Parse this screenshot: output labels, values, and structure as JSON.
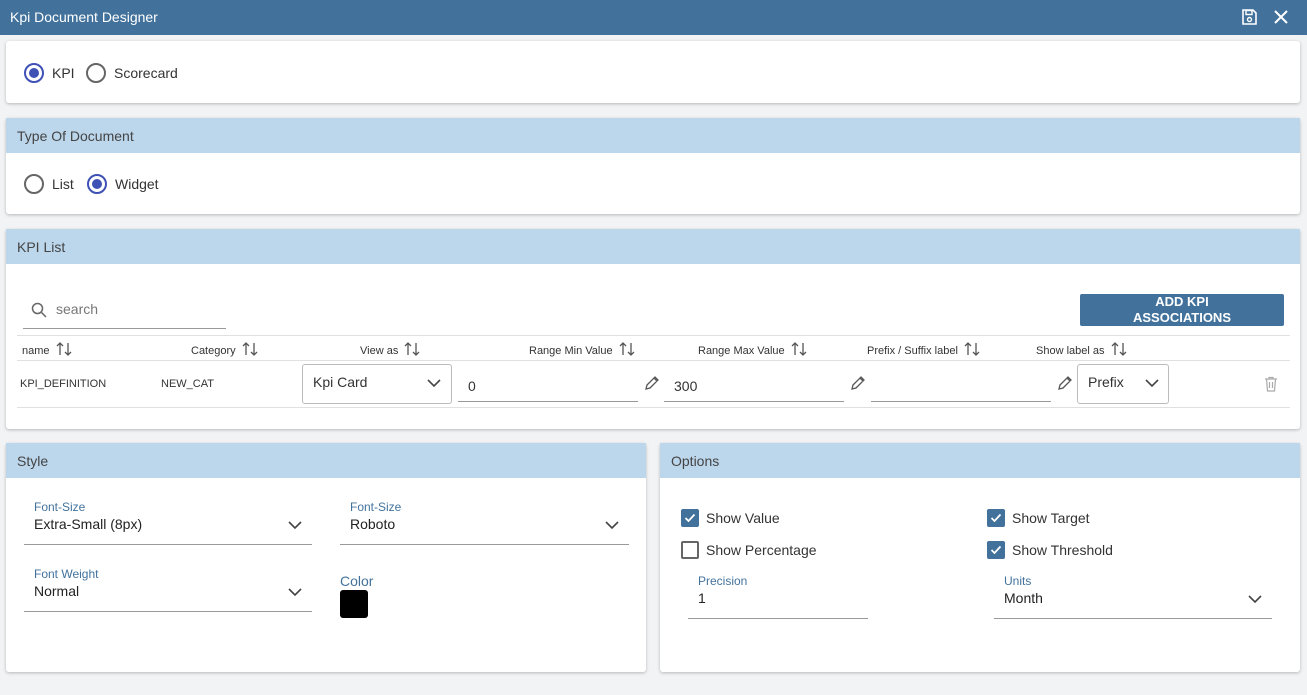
{
  "window": {
    "title": "Kpi Document Designer",
    "save_icon": "save-icon",
    "close_icon": "close-icon"
  },
  "doc_kind": {
    "options": [
      "KPI",
      "Scorecard"
    ],
    "selected": "KPI"
  },
  "type_section": {
    "title": "Type Of Document",
    "options": [
      "List",
      "Widget"
    ],
    "selected": "Widget"
  },
  "kpi_list": {
    "title": "KPI List",
    "search_placeholder": "search",
    "add_button": "ADD KPI ASSOCIATIONS",
    "columns": [
      "name",
      "Category",
      "View as",
      "Range Min Value",
      "Range Max Value",
      "Prefix / Suffix label",
      "Show label as"
    ],
    "rows": [
      {
        "name": "KPI_DEFINITION",
        "category": "NEW_CAT",
        "view_as": "Kpi Card",
        "range_min": "0",
        "range_max": "300",
        "prefix_suffix": "",
        "show_label_as": "Prefix"
      }
    ]
  },
  "style": {
    "title": "Style",
    "font_size": {
      "label": "Font-Size",
      "value": "Extra-Small (8px)"
    },
    "font_family": {
      "label": "Font-Size",
      "value": "Roboto"
    },
    "font_weight": {
      "label": "Font Weight",
      "value": "Normal"
    },
    "color": {
      "label": "Color",
      "value": "#000000"
    }
  },
  "options": {
    "title": "Options",
    "show_value": {
      "label": "Show Value",
      "checked": true
    },
    "show_target": {
      "label": "Show Target",
      "checked": true
    },
    "show_percentage": {
      "label": "Show Percentage",
      "checked": false
    },
    "show_threshold": {
      "label": "Show Threshold",
      "checked": true
    },
    "precision": {
      "label": "Precision",
      "value": "1"
    },
    "units": {
      "label": "Units",
      "value": "Month"
    }
  },
  "colors": {
    "titlebar": "#42729c",
    "section_header": "#bcd6ec",
    "radio_accent": "#3f51b5",
    "checkbox": "#42729c"
  }
}
